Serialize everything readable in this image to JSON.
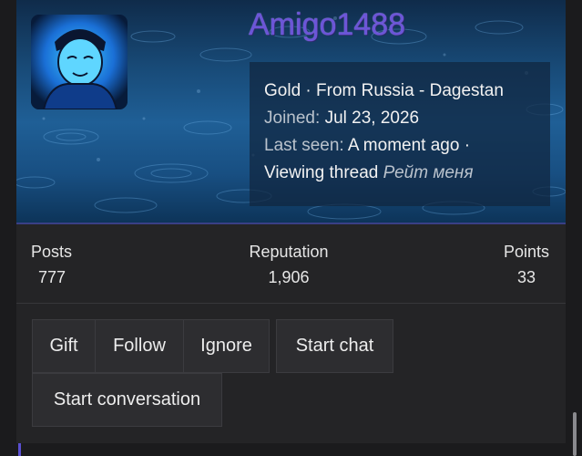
{
  "profile": {
    "username": "Amigo1488",
    "rank": "Gold",
    "location_text": "From Russia - Dagestan",
    "joined_label": "Joined:",
    "joined_value": "Jul 23, 2026",
    "last_seen_label": "Last seen:",
    "last_seen_value": "A moment ago",
    "activity_text": "Viewing thread",
    "activity_thread": "Рейт меня",
    "separator": "·"
  },
  "stats": {
    "posts_label": "Posts",
    "posts_value": "777",
    "reputation_label": "Reputation",
    "reputation_value": "1,906",
    "points_label": "Points",
    "points_value": "33"
  },
  "actions": {
    "gift": "Gift",
    "follow": "Follow",
    "ignore": "Ignore",
    "start_chat": "Start chat",
    "start_conversation": "Start conversation"
  },
  "colors": {
    "username": "#6b55d8",
    "background": "#1b1b1d",
    "card": "#242426",
    "button": "#2d2d30"
  }
}
